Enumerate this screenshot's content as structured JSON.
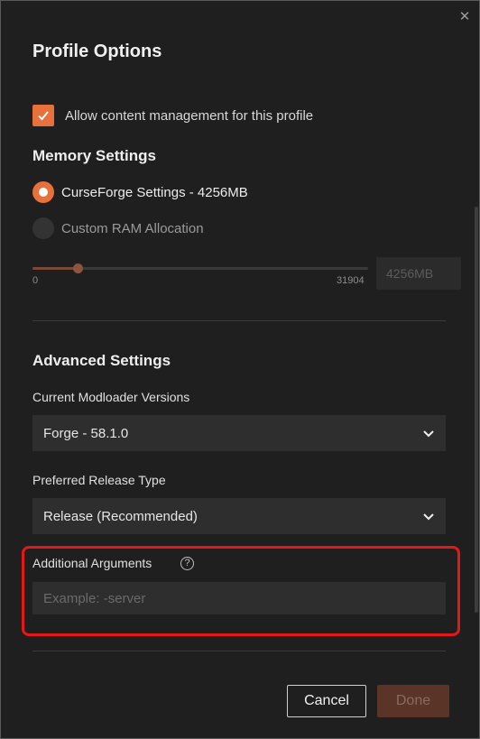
{
  "dialog": {
    "title": "Profile Options",
    "close_icon": "close-icon"
  },
  "content_management": {
    "label": "Allow content management for this profile",
    "checked": true
  },
  "memory": {
    "heading": "Memory Settings",
    "options": [
      {
        "label": "CurseForge Settings - 4256MB",
        "selected": true
      },
      {
        "label": "Custom RAM Allocation",
        "selected": false
      }
    ],
    "slider": {
      "min_label": "0",
      "max_label": "31904",
      "min": 0,
      "max": 31904,
      "value": 4256
    },
    "ram_value": "4256MB"
  },
  "advanced": {
    "heading": "Advanced Settings",
    "modloader_label": "Current Modloader Versions",
    "modloader_value": "Forge - 58.1.0",
    "release_label": "Preferred Release Type",
    "release_value": "Release (Recommended)",
    "args_label": "Additional Arguments",
    "args_help": "?",
    "args_placeholder": "Example: -server",
    "args_value": ""
  },
  "buttons": {
    "cancel": "Cancel",
    "done": "Done"
  },
  "colors": {
    "accent": "#e8703a",
    "background": "#1f1f1f",
    "highlight": "#e31818"
  }
}
